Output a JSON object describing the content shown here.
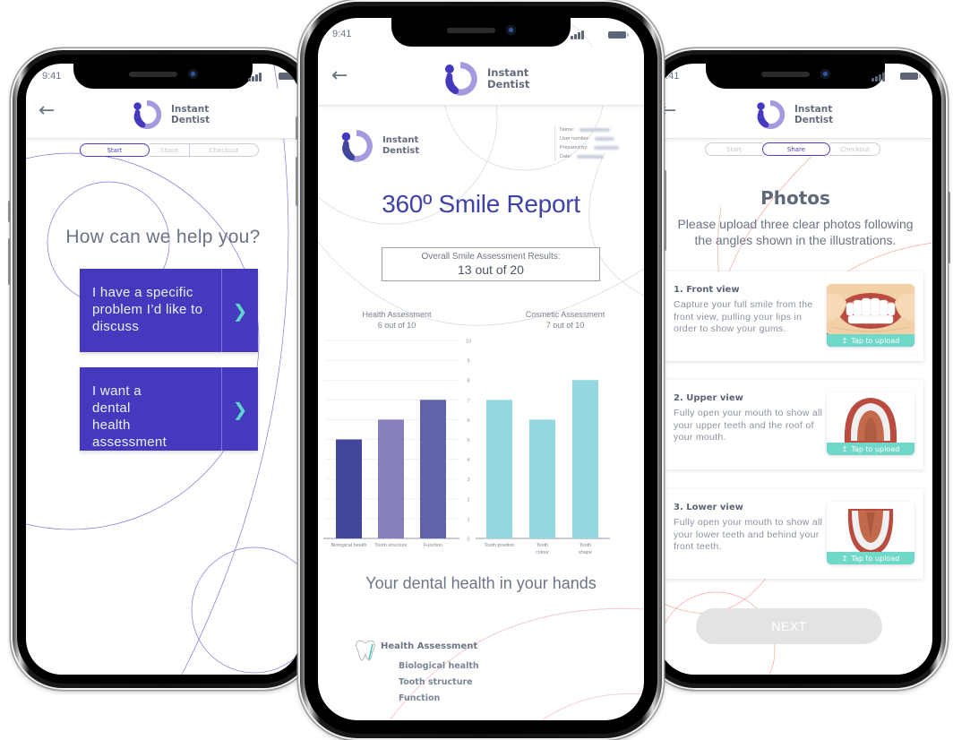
{
  "brand": {
    "name_line1": "Instant",
    "name_line2": "Dentist",
    "colors": {
      "primary": "#4539be",
      "secondary": "#a39ae0",
      "accent_teal": "#6fd8c8",
      "text": "#5d6676"
    }
  },
  "status_bar": {
    "time": "9:41"
  },
  "icons": {
    "back": "arrow-left-icon",
    "chevron": "chevron-right-icon",
    "upload": "upload-icon",
    "tooth": "tooth-icon",
    "signal": "signal-icon",
    "battery": "battery-icon"
  },
  "stepper": {
    "steps": [
      "Start",
      "Share",
      "Checkout"
    ]
  },
  "phone_start": {
    "active_step": "Start",
    "title": "How can we help you?",
    "options": [
      {
        "label": "I have a specific problem I’d like to discuss"
      },
      {
        "label": "I want a dental health assessment"
      }
    ]
  },
  "phone_report": {
    "meta": {
      "labels": [
        "Name:",
        "User number:",
        "Prepared by:",
        "Date:"
      ],
      "values_hidden": true
    },
    "title": "360º Smile Report",
    "overall_label": "Overall Smile Assessment Results:",
    "overall_value": "13 out of 20",
    "health_heading": "Health Assessment",
    "health_score": "6 out of 10",
    "cosmetic_heading": "Cosmetic Assessment",
    "cosmetic_score": "7 out of 10",
    "subtitle": "Your dental health in your hands",
    "legend": {
      "heading": "Health Assessment",
      "items": [
        "Biological health",
        "Tooth structure",
        "Function"
      ]
    }
  },
  "chart_data": [
    {
      "type": "bar",
      "title": "Health Assessment",
      "categories": [
        "Biological health",
        "Tooth structure",
        "Function"
      ],
      "values": [
        5,
        6,
        7
      ],
      "colors": [
        "#43479b",
        "#8580bb",
        "#6163a8"
      ],
      "ylim": [
        0,
        10
      ],
      "yticks": [
        0,
        1,
        2,
        3,
        4,
        5,
        6,
        7,
        8,
        9,
        10
      ],
      "grid": true
    },
    {
      "type": "bar",
      "title": "Cosmetic Assessment",
      "categories": [
        "Tooth position",
        "Tooth colour",
        "Tooth shape"
      ],
      "values": [
        7,
        6,
        8
      ],
      "colors": [
        "#94d7df",
        "#94d7df",
        "#94d7df"
      ],
      "ylim": [
        0,
        10
      ],
      "grid": false
    }
  ],
  "phone_photos": {
    "active_step": "Share",
    "title": "Photos",
    "description": "Please upload three clear photos following the angles shown in the illustrations.",
    "cards": [
      {
        "title": "1. Front view",
        "description": "Capture your full smile from the front view, pulling your lips in order to show your gums.",
        "upload_label": "Tap to upload",
        "illustration": "front-teeth"
      },
      {
        "title": "2. Upper view",
        "description": "Fully open your mouth to show all your upper teeth and the roof of your mouth.",
        "upload_label": "Tap to upload",
        "illustration": "upper-arch"
      },
      {
        "title": "3. Lower view",
        "description": "Fully open your mouth to show all your lower teeth and behind your front teeth.",
        "upload_label": "Tap to upload",
        "illustration": "lower-arch"
      }
    ],
    "next_label": "NEXT",
    "next_enabled": false
  }
}
